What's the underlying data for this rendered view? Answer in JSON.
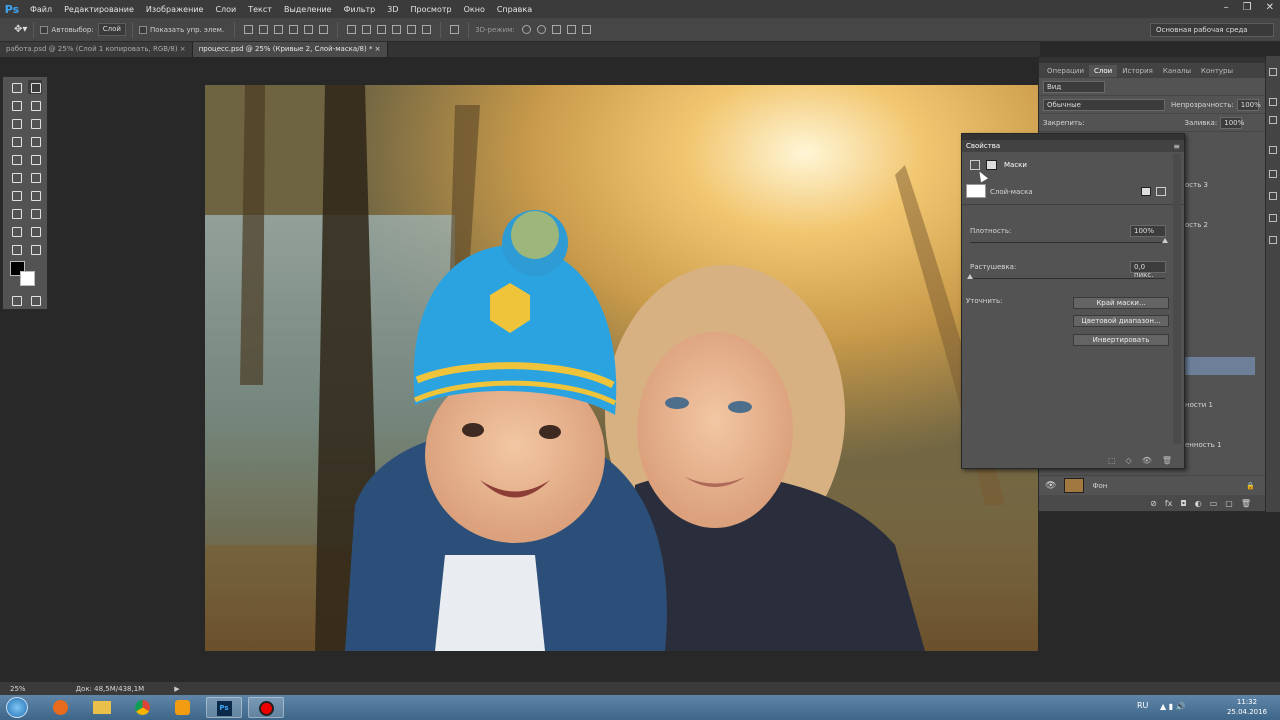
{
  "app": {
    "logo": "Ps"
  },
  "menu": [
    "Файл",
    "Редактирование",
    "Изображение",
    "Слои",
    "Текст",
    "Выделение",
    "Фильтр",
    "3D",
    "Просмотр",
    "Окно",
    "Справка"
  ],
  "options": {
    "autoselect_label": "Автовыбор:",
    "autoselect_value": "Слой",
    "show_transform": "Показать упр. элем.",
    "mode3d": "3D-режим:",
    "workspace": "Основная рабочая среда"
  },
  "tabs": [
    {
      "label": "работа.psd @ 25% (Слой 1 копировать, RGB/8) ×"
    },
    {
      "label": "процесс.psd @ 25% (Кривые 2, Слой-маска/8) * ×"
    }
  ],
  "layers_panel": {
    "tabs": [
      "Операции",
      "Слои",
      "История",
      "Каналы",
      "Контуры"
    ],
    "filter": "Вид",
    "blend": "Обычные",
    "opacity_label": "Непрозрачность:",
    "opacity_value": "100%",
    "lock_label": "Закрепить:",
    "fill_label": "Заливка:",
    "fill_value": "100%",
    "partial_items": [
      "ость 3",
      "ость 2",
      "ности 1",
      "енность 1"
    ],
    "background_layer": "Фон"
  },
  "properties": {
    "title": "Свойства",
    "masks_label": "Маски",
    "layer_mask_label": "Слой-маска",
    "density_label": "Плотность:",
    "density_value": "100%",
    "density_level": 1.0,
    "feather_label": "Растушевка:",
    "feather_value": "0,0 пикс.",
    "feather_level": 0.0,
    "refine_label": "Уточнить:",
    "buttons": [
      "Край маски...",
      "Цветовой диапазон...",
      "Инвертировать"
    ]
  },
  "status": {
    "zoom": "25%",
    "doc": "Док: 48,5M/438,1M"
  },
  "taskbar": {
    "lang": "RU",
    "time": "11:32",
    "date": "25.04.2016"
  },
  "colors": {
    "ps_blue": "#3da5f4",
    "panel": "#535353",
    "selected_layer": "#6d7f99"
  }
}
